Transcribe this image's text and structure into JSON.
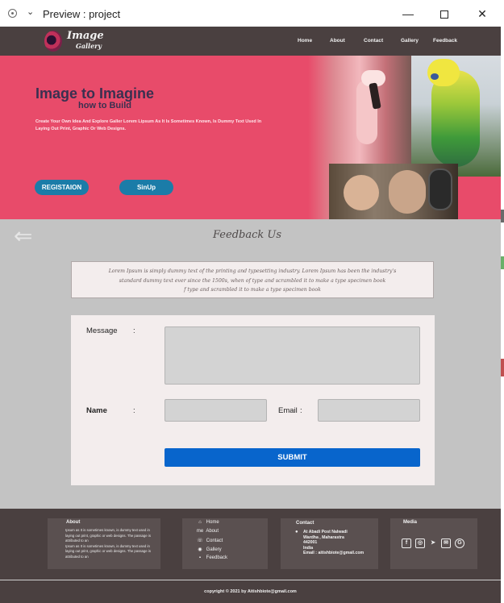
{
  "window": {
    "title": "Preview : project",
    "icons": [
      "record-icon",
      "chevron-down-icon",
      "minimize-icon",
      "maximize-icon",
      "close-icon"
    ]
  },
  "navbar": {
    "logo_line1": "Image",
    "logo_line2": "Gallery",
    "links": [
      "Home",
      "About",
      "Contact",
      "Gallery",
      "Feedback"
    ]
  },
  "hero": {
    "title": "Image to Imagine",
    "subtitle": "how to Build",
    "description": "Create Your Own Idea And Explore Galler  Lorem  Lipsum As It Is Sometimes Known, Is Dummy Text Used In Laying Out Print, Graphic Or Web Designs.",
    "register_label": "REGISTAION",
    "signup_label": "SinUp"
  },
  "feedback": {
    "back_arrow": "⇐",
    "heading": "Feedback Us",
    "lorem_line1": "Lorem Ipsum is simply dummy text of the printing and typesetting industry. Lorem Ipsum has been the industry's",
    "lorem_line2": "standard dummy text ever since the 1500s, when   of type and scrambled it to make a type specimen book",
    "lorem_line3": "f type and scrambled it to make a type specimen book",
    "message_label": "Message",
    "name_label": "Name",
    "email_label": "Email",
    "colon": ":",
    "submit_label": "SUBMIT"
  },
  "footer": {
    "about_title": "About",
    "about_text_1": "Ipsum as It is sometimes known, is dummy text used in laying out print, graphic or web designs. The passage is attributed to an",
    "about_text_2": "Ipsum as It is sometimes known, is dummy text used in laying out print, graphic or web designs. The passage is attributed to an",
    "links": [
      {
        "icon": "home-icon",
        "glyph": "⌂",
        "label": "Home"
      },
      {
        "icon": "about-me-icon",
        "glyph": "me",
        "label": "About"
      },
      {
        "icon": "contact-icon",
        "glyph": "☏",
        "label": "Contact"
      },
      {
        "icon": "gallery-icon",
        "glyph": "◉",
        "label": "Gallery"
      },
      {
        "icon": "feedback-icon",
        "glyph": "▪",
        "label": "Feedback"
      }
    ],
    "contact_title": "Contact",
    "contact_line1": "At Abadi Post Nalwadi",
    "contact_line2": "Wardha , Maharastra",
    "contact_line3": "442001",
    "contact_line4": "India",
    "contact_email": "Email : aitishbiote@gmail.com",
    "media_title": "Media",
    "media_icons": [
      "facebook-icon",
      "instagram-icon",
      "telegram-icon",
      "mail-icon",
      "google-plus-icon"
    ],
    "copyright": "copyright © 2021 by Aitishbiote@gmail.com"
  }
}
